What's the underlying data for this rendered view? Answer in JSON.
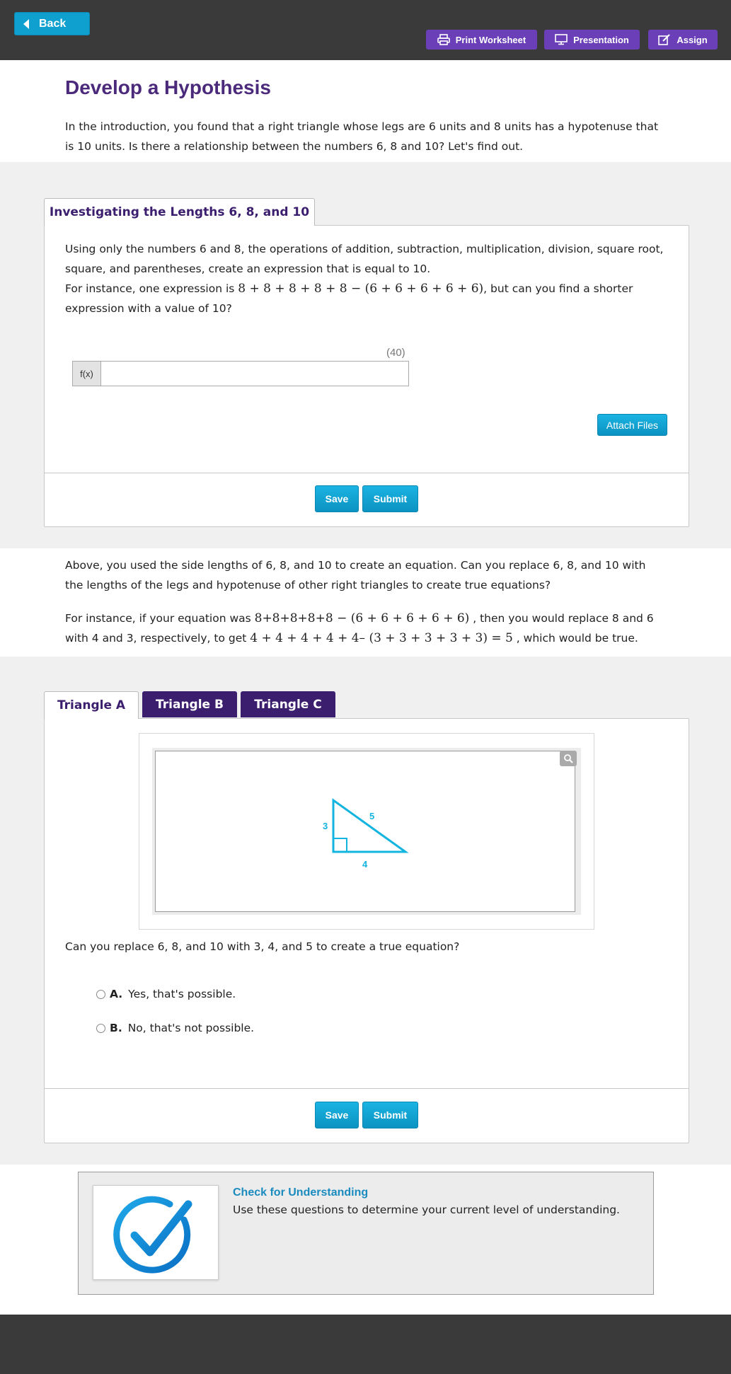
{
  "toolbar": {
    "back_label": "Back",
    "print_label": "Print Worksheet",
    "presentation_label": "Presentation",
    "assign_label": "Assign"
  },
  "header": {
    "title": "Develop a Hypothesis",
    "intro": "In the introduction, you found that a right triangle whose legs are 6 units and 8 units has a hypotenuse that is 10 units. Is there a relationship between the numbers 6, 8 and 10? Let's find out."
  },
  "panel1": {
    "tab_label": "Investigating the Lengths 6, 8, and 10",
    "prompt_line1": "Using only the numbers 6 and 8, the operations of addition, subtraction, multiplication, division, square root, square, and parentheses, create an expression that is equal to 10.",
    "prompt_line2_before": "For instance, one expression is ",
    "prompt_line2_math": "8 + 8 + 8 + 8 + 8 − (6 + 6 + 6 + 6 + 6)",
    "prompt_line2_after": ", but can you find a shorter expression with a value of 10?",
    "char_counter": "(40)",
    "fx_label": "f(x)",
    "input_value": "",
    "attach_label": "Attach Files",
    "save_label": "Save",
    "submit_label": "Submit"
  },
  "middle": {
    "para1": "Above, you used the side lengths of 6, 8, and 10 to create an equation. Can you replace 6, 8, and 10 with the lengths of the legs and hypotenuse of other right triangles to create true equations?",
    "para2_before": "For instance, if your equation was ",
    "para2_math1": "8+8+8+8+8 − (6 + 6 + 6 + 6 + 6)",
    "para2_middle": " , then you would replace 8 and 6 with 4 and 3, respectively, to get ",
    "para2_math2": "4 + 4 + 4 + 4 + 4– (3 + 3 + 3 + 3 + 3) = 5",
    "para2_after": " , which would be true."
  },
  "panel2": {
    "tabs": [
      "Triangle A",
      "Triangle B",
      "Triangle C"
    ],
    "triangle_labels": {
      "left": "3",
      "hyp": "5",
      "bottom": "4"
    },
    "question": "Can you replace 6, 8, and 10 with 3, 4, and 5 to create a true equation?",
    "options": [
      {
        "letter": "A.",
        "text": "Yes, that's possible."
      },
      {
        "letter": "B.",
        "text": "No, that's not possible."
      }
    ],
    "save_label": "Save",
    "submit_label": "Submit"
  },
  "cfu": {
    "title": "Check for Understanding",
    "text": "Use these questions to determine your current level of understanding."
  },
  "colors": {
    "topbar": "#3a3a3a",
    "accent_blue": "#0fa0d0",
    "purple": "#6a3fb8",
    "dark_purple": "#3b1e6e",
    "triangle": "#14b4e0"
  }
}
